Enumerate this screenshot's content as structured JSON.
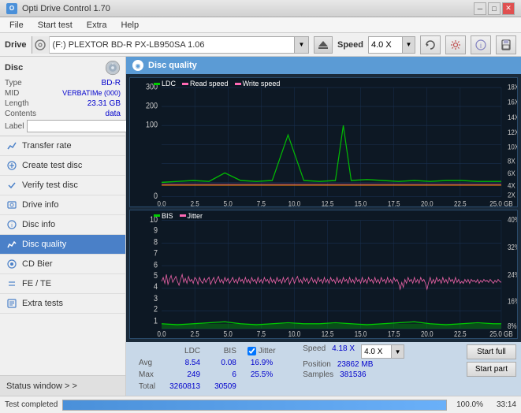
{
  "titleBar": {
    "icon": "O",
    "title": "Opti Drive Control 1.70",
    "minimizeLabel": "─",
    "maximizeLabel": "□",
    "closeLabel": "✕"
  },
  "menuBar": {
    "items": [
      "File",
      "Start test",
      "Extra",
      "Help"
    ]
  },
  "driveBar": {
    "driveLabel": "Drive",
    "driveValue": "(F:) PLEXTOR BD-R  PX-LB950SA 1.06",
    "speedLabel": "Speed",
    "speedValue": "4.0 X"
  },
  "discInfo": {
    "title": "Disc",
    "rows": [
      {
        "key": "Type",
        "val": "BD-R",
        "blue": true
      },
      {
        "key": "MID",
        "val": "VERBATIMe (000)",
        "blue": true
      },
      {
        "key": "Length",
        "val": "23.31 GB",
        "blue": true
      },
      {
        "key": "Contents",
        "val": "data",
        "blue": true
      },
      {
        "key": "Label",
        "val": "",
        "blue": false
      }
    ]
  },
  "navItems": [
    {
      "id": "transfer-rate",
      "label": "Transfer rate",
      "active": false
    },
    {
      "id": "create-test-disc",
      "label": "Create test disc",
      "active": false
    },
    {
      "id": "verify-test-disc",
      "label": "Verify test disc",
      "active": false
    },
    {
      "id": "drive-info",
      "label": "Drive info",
      "active": false
    },
    {
      "id": "disc-info",
      "label": "Disc info",
      "active": false
    },
    {
      "id": "disc-quality",
      "label": "Disc quality",
      "active": true
    },
    {
      "id": "cd-bier",
      "label": "CD Bier",
      "active": false
    },
    {
      "id": "fe-te",
      "label": "FE / TE",
      "active": false
    },
    {
      "id": "extra-tests",
      "label": "Extra tests",
      "active": false
    }
  ],
  "statusWindow": {
    "label": "Status window > >"
  },
  "chartHeader": {
    "title": "Disc quality"
  },
  "topChart": {
    "legend": [
      {
        "label": "LDC",
        "color": "#00cc00"
      },
      {
        "label": "Read speed",
        "color": "#ff69b4"
      },
      {
        "label": "Write speed",
        "color": "#ff69b4"
      }
    ],
    "yAxisLeft": [
      "300",
      "200",
      "100",
      "0"
    ],
    "yAxisRight": [
      "18X",
      "16X",
      "14X",
      "12X",
      "10X",
      "8X",
      "6X",
      "4X",
      "2X"
    ],
    "xAxis": [
      "0.0",
      "2.5",
      "5.0",
      "7.5",
      "10.0",
      "12.5",
      "15.0",
      "17.5",
      "20.0",
      "22.5",
      "25.0 GB"
    ]
  },
  "bottomChart": {
    "legend": [
      {
        "label": "BIS",
        "color": "#00cc00"
      },
      {
        "label": "Jitter",
        "color": "#ff69b4"
      }
    ],
    "yAxisLeft": [
      "10",
      "9",
      "8",
      "7",
      "6",
      "5",
      "4",
      "3",
      "2",
      "1"
    ],
    "yAxisRight": [
      "40%",
      "32%",
      "24%",
      "16%",
      "8%"
    ],
    "xAxis": [
      "0.0",
      "2.5",
      "5.0",
      "7.5",
      "10.0",
      "12.5",
      "15.0",
      "17.5",
      "20.0",
      "22.5",
      "25.0 GB"
    ]
  },
  "stats": {
    "columns": [
      "",
      "LDC",
      "BIS",
      "",
      "Jitter",
      "Speed",
      ""
    ],
    "rows": [
      {
        "label": "Avg",
        "ldc": "8.54",
        "bis": "0.08",
        "jitter": "16.9%",
        "speed": "4.18 X",
        "speedSelect": "4.0 X"
      },
      {
        "label": "Max",
        "ldc": "249",
        "bis": "6",
        "jitter": "25.5%"
      },
      {
        "label": "Total",
        "ldc": "3260813",
        "bis": "30509",
        "jitter": ""
      }
    ],
    "position": {
      "label": "Position",
      "value": "23862 MB"
    },
    "samples": {
      "label": "Samples",
      "value": "381536"
    },
    "jitterChecked": true,
    "startFull": "Start full",
    "startPart": "Start part"
  },
  "progressBar": {
    "statusLabel": "Test completed",
    "percent": 100,
    "percentLabel": "100.0%",
    "time": "33:14"
  }
}
